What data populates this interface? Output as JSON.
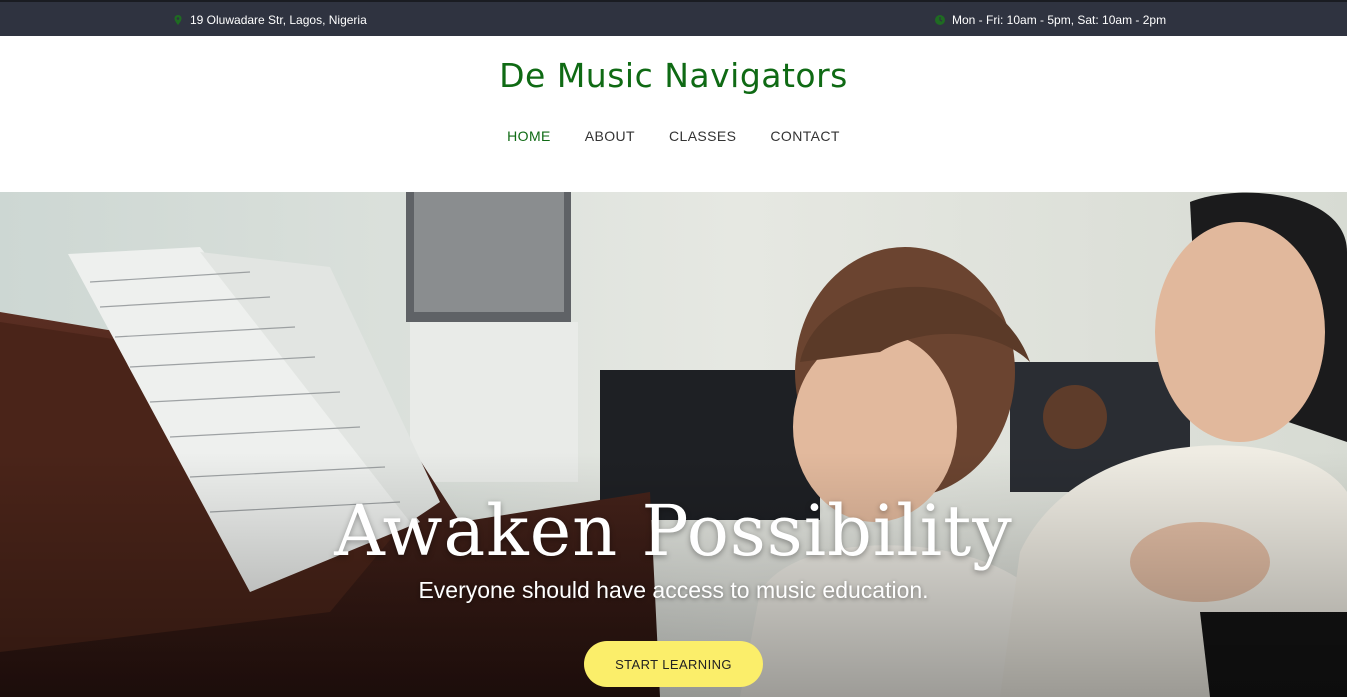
{
  "topbar": {
    "address": "19 Oluwadare Str, Lagos, Nigeria",
    "address_icon": "map-pin-icon",
    "hours": "Mon - Fri: 10am - 5pm, Sat: 10am - 2pm",
    "hours_icon": "clock-icon"
  },
  "header": {
    "brand": "De Music Navigators",
    "nav": [
      {
        "label": "HOME",
        "active": true
      },
      {
        "label": "ABOUT",
        "active": false
      },
      {
        "label": "CLASSES",
        "active": false
      },
      {
        "label": "CONTACT",
        "active": false
      }
    ]
  },
  "hero": {
    "title": "Awaken Possibility",
    "subtitle": "Everyone should have access to music education.",
    "cta_label": "START LEARNING"
  },
  "colors": {
    "topbar_bg": "#2f3340",
    "brand_green": "#0f6a14",
    "cta_yellow": "#fbee6a"
  }
}
